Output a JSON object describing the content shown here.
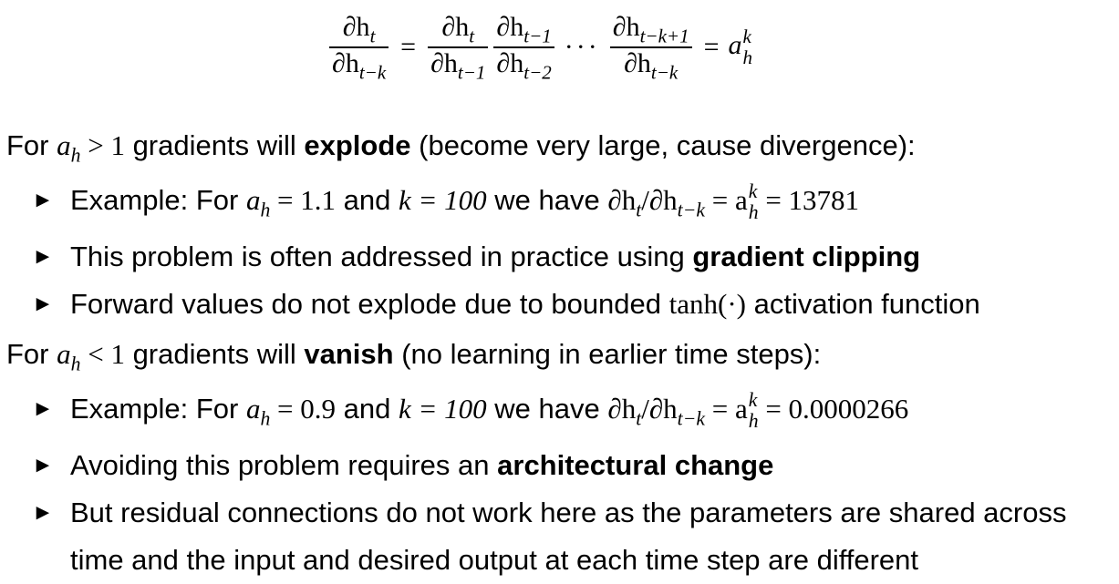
{
  "equation": {
    "lhs_num": "∂h",
    "lhs_num_sub": "t",
    "lhs_den": "∂h",
    "lhs_den_sub": "t−k",
    "f1_num": "∂h",
    "f1_num_sub": "t",
    "f1_den": "∂h",
    "f1_den_sub": "t−1",
    "f2_num": "∂h",
    "f2_num_sub": "t−1",
    "f2_den": "∂h",
    "f2_den_sub": "t−2",
    "dots": "···",
    "f3_num": "∂h",
    "f3_num_sub": "t−k+1",
    "f3_den": "∂h",
    "f3_den_sub": "t−k",
    "eq": "=",
    "rhs": "a",
    "rhs_sup": "k",
    "rhs_sub": "h"
  },
  "explode": {
    "intro_pre": "For ",
    "intro_var": "a",
    "intro_var_sub": "h",
    "intro_cond": " > 1",
    "intro_mid": " gradients will ",
    "intro_bold": "explode",
    "intro_post": " (become very large, cause divergence):",
    "bullet1_pre": "Example: For ",
    "bullet1_math1": "a",
    "bullet1_math1_sub": "h",
    "bullet1_math1_rest": " = 1.1",
    "bullet1_and": " and ",
    "bullet1_math2": "k = 100",
    "bullet1_have": " we have ",
    "bullet1_math3": "∂h",
    "bullet1_math3_sub": "t",
    "bullet1_math3_slash": "/∂h",
    "bullet1_math3_sub2": "t−k",
    "bullet1_eq": " = a",
    "bullet1_sup": "k",
    "bullet1_sub": "h",
    "bullet1_value": " = 13781",
    "bullet2_pre": "This problem is often addressed in practice using ",
    "bullet2_bold": "gradient clipping",
    "bullet3_pre": "Forward values do not explode due to bounded ",
    "bullet3_math": "tanh(·)",
    "bullet3_post": " activation function"
  },
  "vanish": {
    "intro_pre": "For ",
    "intro_var": "a",
    "intro_var_sub": "h",
    "intro_cond": " < 1",
    "intro_mid": " gradients will ",
    "intro_bold": "vanish",
    "intro_post": " (no learning in earlier time steps):",
    "bullet1_pre": "Example: For ",
    "bullet1_math1": "a",
    "bullet1_math1_sub": "h",
    "bullet1_math1_rest": " = 0.9",
    "bullet1_and": " and ",
    "bullet1_math2": "k = 100",
    "bullet1_have": " we have ",
    "bullet1_math3": "∂h",
    "bullet1_math3_sub": "t",
    "bullet1_math3_slash": "/∂h",
    "bullet1_math3_sub2": "t−k",
    "bullet1_eq": " = a",
    "bullet1_sup": "k",
    "bullet1_sub": "h",
    "bullet1_value": " = 0.0000266",
    "bullet2_pre": "Avoiding this problem requires an ",
    "bullet2_bold": "architectural change",
    "bullet3_text": "But residual connections do not work here as the parameters are shared across time and the input and desired output at each time step are different"
  },
  "bullet_glyph": "►"
}
